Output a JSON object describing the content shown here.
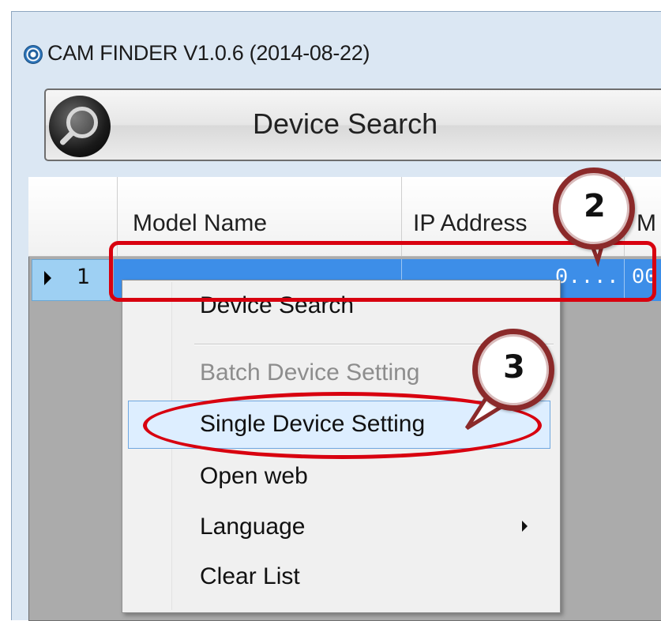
{
  "window": {
    "title": "CAM FINDER V1.0.6 (2014-08-22)"
  },
  "toolbar": {
    "search_label": "Device Search"
  },
  "grid": {
    "columns": [
      "Model Name",
      "IP Address",
      "M"
    ],
    "rows": [
      {
        "index": "1",
        "ip": "0....",
        "mac": "00"
      }
    ]
  },
  "context_menu": {
    "items": [
      {
        "label": "Device Search",
        "enabled": true
      },
      {
        "label": "Batch Device Setting",
        "enabled": false
      },
      {
        "label": "Single Device Setting",
        "enabled": true,
        "highlighted": true
      },
      {
        "label": "Open web",
        "enabled": true
      },
      {
        "label": "Language",
        "enabled": true,
        "submenu": true
      },
      {
        "label": "Clear List",
        "enabled": true
      }
    ]
  },
  "annotations": {
    "callout_2": "2",
    "callout_3": "3",
    "color": "#d8000f"
  }
}
